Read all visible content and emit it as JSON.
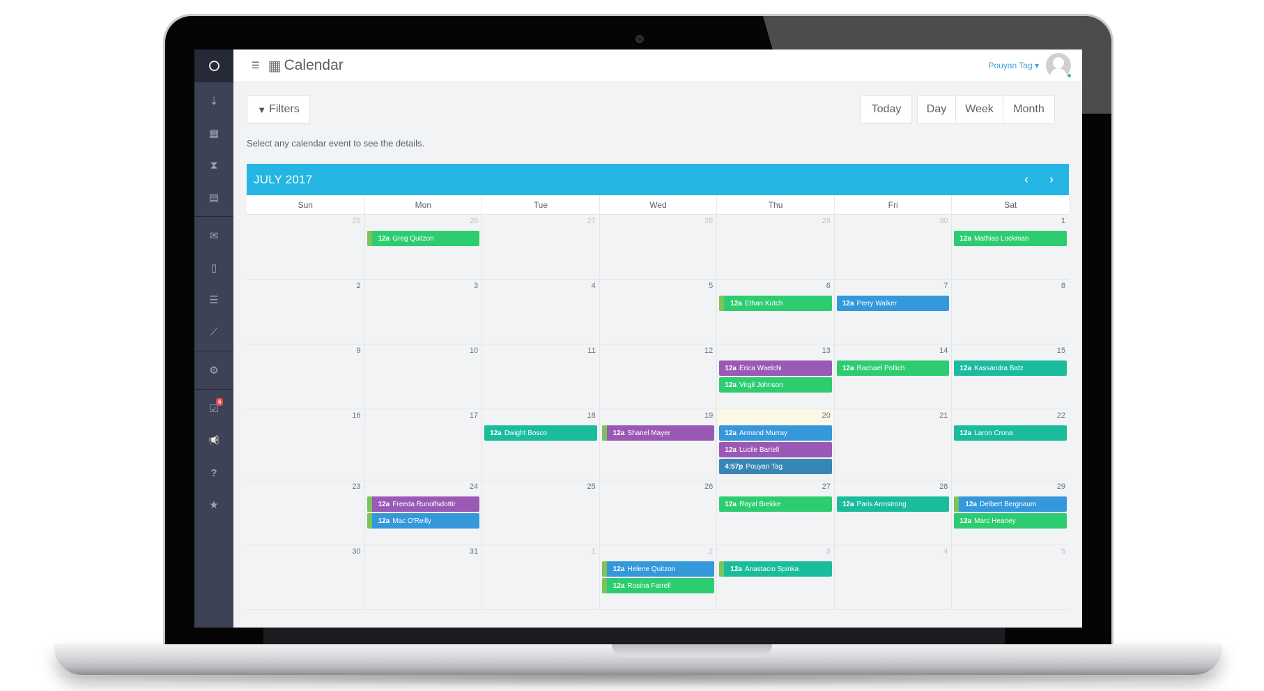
{
  "colors": {
    "green": "#2ecc71",
    "blue": "#3498db",
    "purple": "#9b59b6",
    "teal": "#1abc9c",
    "steel": "#3886b3",
    "accent": "#25b5e2"
  },
  "sidebar": {
    "items": [
      {
        "icon": "loader-icon",
        "glyph": "◯"
      },
      {
        "icon": "sort-list-icon",
        "glyph": "⇣"
      },
      {
        "icon": "calendar-icon",
        "glyph": "▦"
      },
      {
        "icon": "hourglass-icon",
        "glyph": "⧗"
      },
      {
        "icon": "id-card-icon",
        "glyph": "▤"
      },
      {
        "icon": "envelope-icon",
        "glyph": "✉"
      },
      {
        "icon": "mobile-icon",
        "glyph": "▯"
      },
      {
        "icon": "server-icon",
        "glyph": "☰"
      },
      {
        "icon": "line-chart-icon",
        "glyph": "⟋"
      },
      {
        "icon": "cogs-icon",
        "glyph": "⚙"
      },
      {
        "icon": "tasks-icon",
        "glyph": "☑",
        "badge": "6"
      },
      {
        "icon": "megaphone-icon",
        "glyph": "📢"
      },
      {
        "icon": "help-icon",
        "glyph": "?"
      },
      {
        "icon": "star-icon",
        "glyph": "★"
      }
    ]
  },
  "header": {
    "title": "Calendar",
    "user_name": "Pouyan Tag",
    "user_caret": "▾"
  },
  "toolbar": {
    "filters_label": "Filters",
    "today_label": "Today",
    "views": [
      "Day",
      "Week",
      "Month"
    ],
    "helper_text": "Select any calendar event to see the details."
  },
  "calendar": {
    "month_title": "JULY 2017",
    "prev_glyph": "‹",
    "next_glyph": "›",
    "weekdays": [
      "Sun",
      "Mon",
      "Tue",
      "Wed",
      "Thu",
      "Fri",
      "Sat"
    ],
    "weeks": [
      [
        {
          "day": "25",
          "other": true,
          "events": []
        },
        {
          "day": "26",
          "other": true,
          "events": [
            {
              "time": "12a",
              "title": "Greg Quitzon",
              "color": "green",
              "stripe": true
            }
          ]
        },
        {
          "day": "27",
          "other": true,
          "events": []
        },
        {
          "day": "28",
          "other": true,
          "events": []
        },
        {
          "day": "29",
          "other": true,
          "events": []
        },
        {
          "day": "30",
          "other": true,
          "events": []
        },
        {
          "day": "1",
          "events": [
            {
              "time": "12a",
              "title": "Mathias Lockman",
              "color": "green"
            }
          ]
        }
      ],
      [
        {
          "day": "2",
          "events": []
        },
        {
          "day": "3",
          "events": []
        },
        {
          "day": "4",
          "events": []
        },
        {
          "day": "5",
          "events": []
        },
        {
          "day": "6",
          "events": [
            {
              "time": "12a",
              "title": "Ethan Kutch",
              "color": "green",
              "stripe": true
            }
          ]
        },
        {
          "day": "7",
          "events": [
            {
              "time": "12a",
              "title": "Perry Walker",
              "color": "blue"
            }
          ]
        },
        {
          "day": "8",
          "events": []
        }
      ],
      [
        {
          "day": "9",
          "events": []
        },
        {
          "day": "10",
          "events": []
        },
        {
          "day": "11",
          "events": []
        },
        {
          "day": "12",
          "events": []
        },
        {
          "day": "13",
          "events": [
            {
              "time": "12a",
              "title": "Erica Waelchi",
              "color": "purple"
            },
            {
              "time": "12a",
              "title": "Virgil Johnson",
              "color": "green"
            }
          ]
        },
        {
          "day": "14",
          "events": [
            {
              "time": "12a",
              "title": "Rachael Pollich",
              "color": "green"
            }
          ]
        },
        {
          "day": "15",
          "events": [
            {
              "time": "12a",
              "title": "Kassandra Batz",
              "color": "teal"
            }
          ]
        }
      ],
      [
        {
          "day": "16",
          "events": []
        },
        {
          "day": "17",
          "events": []
        },
        {
          "day": "18",
          "events": [
            {
              "time": "12a",
              "title": "Dwight Bosco",
              "color": "teal"
            }
          ]
        },
        {
          "day": "19",
          "events": [
            {
              "time": "12a",
              "title": "Shanel Mayer",
              "color": "purple",
              "stripe": true
            }
          ]
        },
        {
          "day": "20",
          "today": true,
          "events": [
            {
              "time": "12a",
              "title": "Armand Murray",
              "color": "blue"
            },
            {
              "time": "12a",
              "title": "Lucile Bartell",
              "color": "purple"
            },
            {
              "time": "4:57p",
              "title": "Pouyan Tag",
              "color": "steel"
            }
          ]
        },
        {
          "day": "21",
          "events": []
        },
        {
          "day": "22",
          "events": [
            {
              "time": "12a",
              "title": "Laron Crona",
              "color": "teal"
            }
          ]
        }
      ],
      [
        {
          "day": "23",
          "events": []
        },
        {
          "day": "24",
          "events": [
            {
              "time": "12a",
              "title": "Freeda Runolfsdottir",
              "color": "purple",
              "stripe": true
            },
            {
              "time": "12a",
              "title": "Mac O'Reilly",
              "color": "blue",
              "stripe": true
            }
          ]
        },
        {
          "day": "25",
          "events": []
        },
        {
          "day": "26",
          "events": []
        },
        {
          "day": "27",
          "events": [
            {
              "time": "12a",
              "title": "Royal Brekke",
              "color": "green"
            }
          ]
        },
        {
          "day": "28",
          "events": [
            {
              "time": "12a",
              "title": "Paris Armstrong",
              "color": "teal"
            }
          ]
        },
        {
          "day": "29",
          "events": [
            {
              "time": "12a",
              "title": "Delbert Bergnaum",
              "color": "blue",
              "stripe": true
            },
            {
              "time": "12a",
              "title": "Marc Heaney",
              "color": "green"
            }
          ]
        }
      ],
      [
        {
          "day": "30",
          "events": []
        },
        {
          "day": "31",
          "events": []
        },
        {
          "day": "1",
          "other": true,
          "events": []
        },
        {
          "day": "2",
          "other": true,
          "events": [
            {
              "time": "12a",
              "title": "Helene Quitzon",
              "color": "blue",
              "stripe": true
            },
            {
              "time": "12a",
              "title": "Rosina Farrell",
              "color": "green",
              "stripe": true
            }
          ]
        },
        {
          "day": "3",
          "other": true,
          "events": [
            {
              "time": "12a",
              "title": "Anastacio Spinka",
              "color": "teal",
              "stripe": true
            }
          ]
        },
        {
          "day": "4",
          "other": true,
          "events": []
        },
        {
          "day": "5",
          "other": true,
          "events": []
        }
      ]
    ]
  }
}
